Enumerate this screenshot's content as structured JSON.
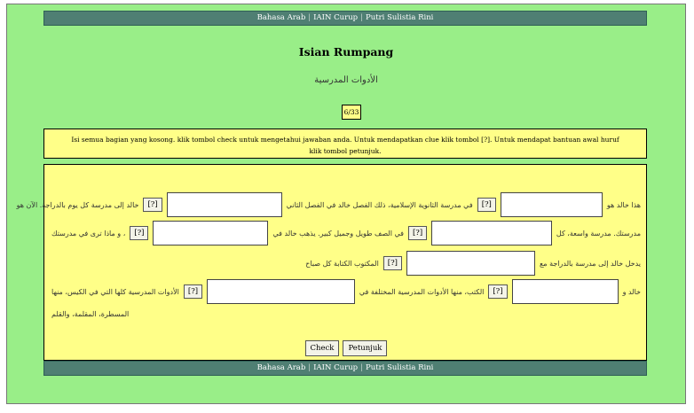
{
  "nav": {
    "links": [
      "Bahasa Arab",
      "IAIN Curup",
      "Putri Sulistia Rini"
    ],
    "separator": "|"
  },
  "page": {
    "title": "Isian Rumpang",
    "subtitle": "الأدوات المدرسية",
    "counter": "6/33"
  },
  "instructions": "Isi semua bagian yang kosong. klik tombol check untuk mengetahui jawaban anda. Untuk mendapatkan clue klik tombol [?]. Untuk mendapat bantuan awal huruf klik tombol petunjuk.",
  "exercise": {
    "hint_label": "[?]",
    "row1": {
      "text_a": "هذا خالد هو",
      "text_b": "في مدرسة الثانوية الإسلامية، ذلك الفصل خالد في الفصل الثاني",
      "text_c": "خالد إلى مدرسة كل يوم بالدراجة. الآن هو"
    },
    "row2": {
      "text_a": "مدرستك. مدرسة واسعة، كل",
      "text_b": "في الصف طويل وجميل كبير. يذهب خالد في",
      "text_c": "، و ماذا ترى في مدرستك"
    },
    "row3": {
      "text_a": "يدخل خالد إلى مدرسة بالدراجة مع",
      "text_b": "المكتوب الكتابة كل صباح"
    },
    "row4": {
      "text_a": "خالد و",
      "text_b": "الكتب، منها الأدوات المدرسية المختلفة في",
      "text_c": "الأدوات المدرسية كلها التي في الكيس، منها"
    },
    "row5": {
      "text_a": "المسطرة، المقلمة، والقلم"
    },
    "check_label": "Check",
    "hint_button_label": "Petunjuk"
  },
  "colors": {
    "page_background": "#99ee88",
    "navbar": "#4f7f73",
    "panel": "#ffff88"
  }
}
